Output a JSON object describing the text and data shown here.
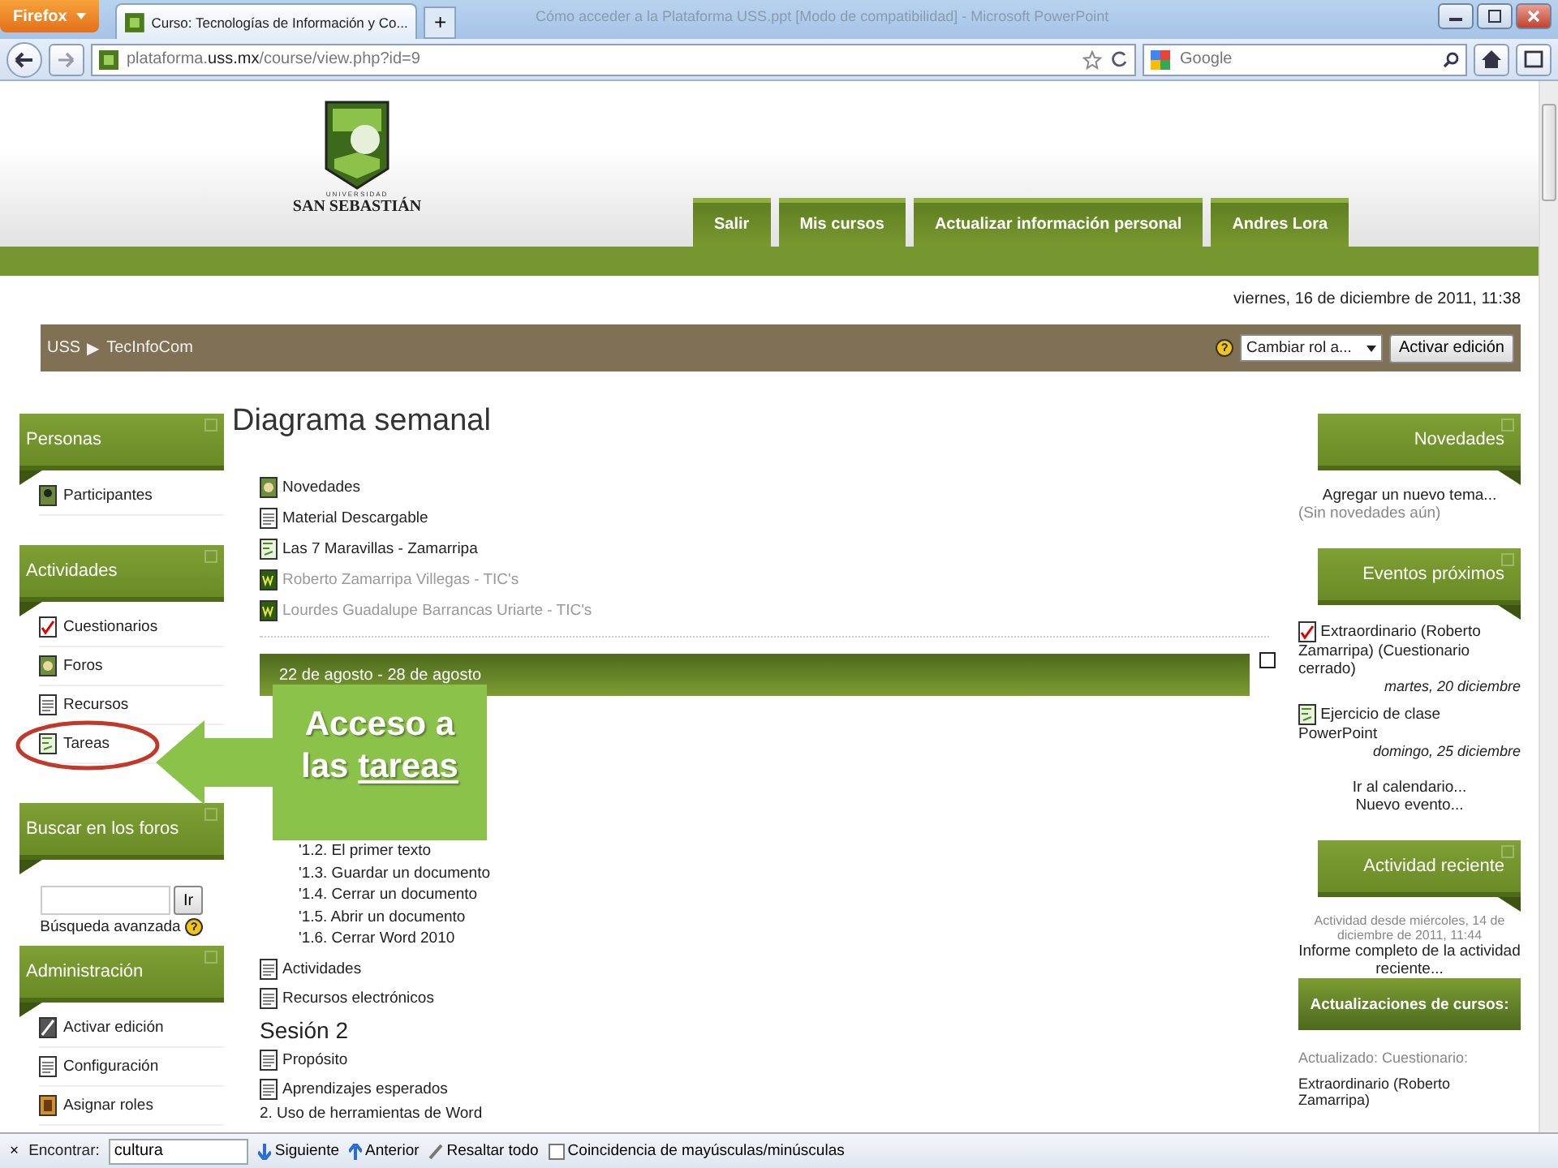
{
  "browser": {
    "menu_button": "Firefox",
    "tab_title": "Curso: Tecnologías de Información y Co...",
    "new_tab": "+",
    "window_title": "Cómo acceder a la Plataforma USS.ppt [Modo de compatibilidad] - Microsoft PowerPoint",
    "url_prefix": "plataforma.",
    "url_domain": "uss.mx",
    "url_path": "/course/view.php?id=9",
    "search_placeholder": "Google"
  },
  "header": {
    "logo_small": "UNIVERSIDAD",
    "logo_name": "SAN SEBASTIÁN",
    "nav": [
      "Salir",
      "Mis cursos",
      "Actualizar información personal",
      "Andres Lora"
    ]
  },
  "date": "viernes, 16 de diciembre de 2011, 11:38",
  "breadcrumb": {
    "items": [
      "USS",
      "TecInfoCom"
    ],
    "separator": "▶"
  },
  "role_select": "Cambiar rol a...",
  "edit_button": "Activar edición",
  "left_blocks": [
    {
      "kind": "list",
      "title": "Personas",
      "items": [
        {
          "label": "Participantes",
          "kind": "people"
        }
      ]
    },
    {
      "kind": "list",
      "title": "Actividades",
      "items": [
        {
          "label": "Cuestionarios",
          "kind": "quiz"
        },
        {
          "label": "Foros",
          "kind": "forum"
        },
        {
          "label": "Recursos",
          "kind": "doc"
        },
        {
          "label": "Tareas",
          "kind": "assignment"
        }
      ]
    },
    {
      "kind": "search",
      "title": "Buscar en los foros",
      "button": "Ir",
      "link": "Búsqueda avanzada"
    },
    {
      "kind": "list",
      "title": "Administración",
      "items": [
        {
          "label": "Activar edición",
          "kind": "edit"
        },
        {
          "label": "Configuración",
          "kind": "doc"
        },
        {
          "label": "Asignar roles",
          "kind": "roles"
        }
      ]
    }
  ],
  "main": {
    "title": "Diagrama semanal",
    "top_items": [
      {
        "label": "Novedades",
        "kind": "forum",
        "dimmed": false
      },
      {
        "label": "Material Descargable",
        "kind": "file",
        "dimmed": false
      },
      {
        "label": "Las 7 Maravillas - Zamarripa",
        "kind": "assignment",
        "dimmed": false
      },
      {
        "label": "Roberto Zamarripa Villegas - TIC's",
        "kind": "wiki",
        "dimmed": true
      },
      {
        "label": "Lourdes Guadalupe Barrancas Uriarte - TIC's",
        "kind": "wiki",
        "dimmed": true
      }
    ],
    "week": "22 de agosto - 28 de agosto",
    "subitems": [
      "'1.2. El primer texto",
      "'1.3. Guardar un documento",
      "'1.4. Cerrar un documento",
      "'1.5. Abrir un documento",
      "'1.6. Cerrar Word 2010"
    ],
    "rest": [
      {
        "kind": "doc",
        "label": "Actividades"
      },
      {
        "kind": "doc",
        "label": "Recursos electrónicos"
      },
      {
        "kind": "heading",
        "label": "Sesión 2"
      },
      {
        "kind": "doc",
        "label": "Propósito"
      },
      {
        "kind": "doc",
        "label": "Aprendizajes esperados"
      },
      {
        "kind": "text",
        "label": "2. Uso de herramientas de Word"
      }
    ]
  },
  "callout": {
    "text": "Acceso a las",
    "underlined": "tareas"
  },
  "right": {
    "news": {
      "title": "Novedades",
      "link": "Agregar un nuevo tema...",
      "note": "(Sin novedades aún)"
    },
    "events": {
      "title": "Eventos próximos",
      "items": [
        {
          "label": "Extraordinario (Roberto Zamarripa) (Cuestionario cerrado)",
          "date": "martes, 20 diciembre",
          "kind": "quiz"
        },
        {
          "label": "Ejercicio de clase PowerPoint",
          "date": "domingo, 25 diciembre",
          "kind": "assignment"
        }
      ],
      "links": [
        "Ir al calendario...",
        "Nuevo evento..."
      ]
    },
    "recent": {
      "title": "Actividad reciente",
      "since": "Actividad desde miércoles, 14 de diciembre de 2011, 11:44",
      "link": "Informe completo de la actividad reciente...",
      "subheader": "Actualizaciones de cursos:",
      "updated_label": "Actualizado: Cuestionario:",
      "updated_item": "Extraordinario (Roberto Zamarripa)"
    }
  },
  "find_bar": {
    "close": "×",
    "label": "Encontrar:",
    "value": "cultura",
    "next": "Siguiente",
    "prev": "Anterior",
    "highlight": "Resaltar todo",
    "match_case": {
      "label": "Coincidencia de mayúsculas/minúsculas",
      "checked": false
    }
  }
}
